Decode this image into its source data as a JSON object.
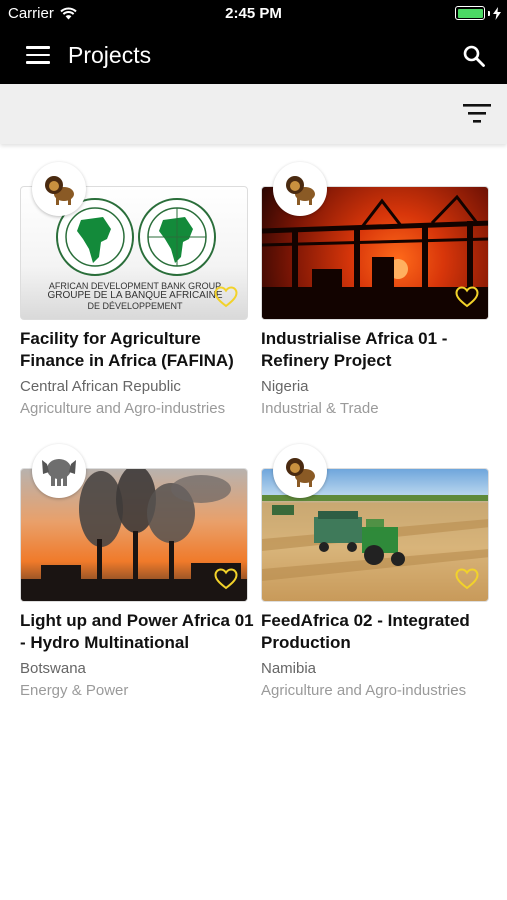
{
  "status_bar": {
    "carrier": "Carrier",
    "time": "2:45 PM"
  },
  "header": {
    "title": "Projects"
  },
  "projects": [
    {
      "title": "Facility for Agriculture Finance in Africa (FAFINA)",
      "country": "Central African Republic",
      "sector": "Agriculture and Agro-industries",
      "avatar_icon": "lion-icon",
      "image_caption_line1": "AFRICAN DEVELOPMENT BANK GROUP",
      "image_caption_line2": "GROUPE DE LA BANQUE AFRICAINE",
      "image_caption_line3": "DE DÉVELOPPEMENT"
    },
    {
      "title": "Industrialise Africa 01 - Refinery Project",
      "country": "Nigeria",
      "sector": "Industrial & Trade",
      "avatar_icon": "lion-icon"
    },
    {
      "title": "Light up and Power Africa 01 - Hydro Multinational",
      "country": "Botswana",
      "sector": "Energy & Power",
      "avatar_icon": "elephant-icon"
    },
    {
      "title": "FeedAfrica 02 - Integrated Production",
      "country": "Namibia",
      "sector": "Agriculture and Agro-industries",
      "avatar_icon": "lion-icon"
    }
  ],
  "colors": {
    "favorite": "#f2d22a",
    "battery": "#4cd964",
    "header_bg": "#000000",
    "filterbar_bg": "#efefef"
  }
}
